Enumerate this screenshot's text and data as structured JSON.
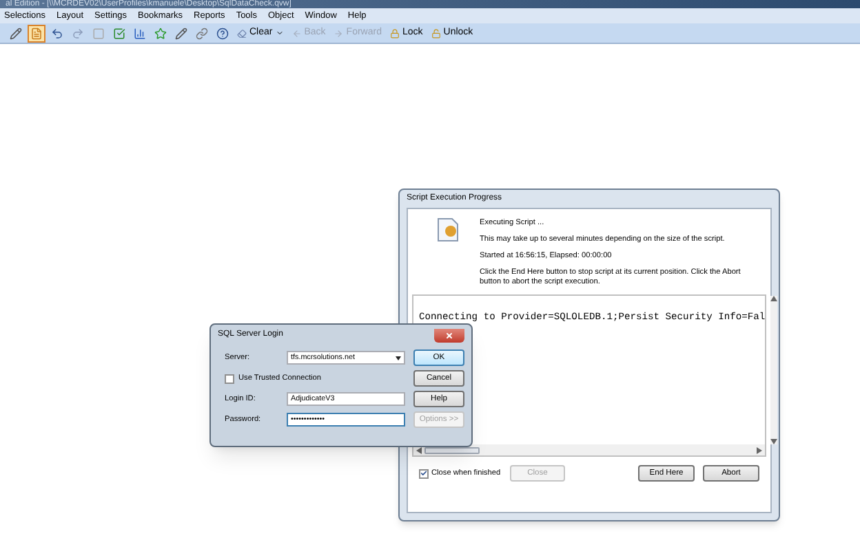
{
  "window": {
    "title": "al Edition - [\\\\MCRDEV02\\UserProfiles\\kmanuele\\Desktop\\SqlDataCheck.qvw]"
  },
  "menu": [
    "Selections",
    "Layout",
    "Settings",
    "Bookmarks",
    "Reports",
    "Tools",
    "Object",
    "Window",
    "Help"
  ],
  "toolbar": [
    {
      "kind": "icon",
      "selected": false
    },
    {
      "kind": "icon",
      "selected": true
    },
    {
      "kind": "icon",
      "selected": false
    },
    {
      "kind": "icon",
      "selected": false
    },
    {
      "kind": "icon",
      "selected": false
    },
    {
      "kind": "icon",
      "selected": false
    },
    {
      "kind": "icon",
      "selected": false
    },
    {
      "kind": "icon",
      "selected": false
    },
    {
      "kind": "icon",
      "selected": false
    },
    {
      "kind": "icon",
      "selected": false
    },
    {
      "kind": "icon",
      "selected": false
    },
    {
      "kind": "dropdown",
      "label": "Clear",
      "disabled": false
    },
    {
      "kind": "button",
      "label": "Back",
      "disabled": true
    },
    {
      "kind": "button",
      "label": "Forward",
      "disabled": true
    },
    {
      "kind": "button",
      "label": "Lock",
      "disabled": false
    },
    {
      "kind": "button",
      "label": "Unlock",
      "disabled": false
    }
  ],
  "script_dialog": {
    "title": "Script Execution Progress",
    "heading": "Executing Script ...",
    "lines": [
      "This may take up to several minutes depending on the size of the script.",
      "Started at 16:56:15, Elapsed: 00:00:00",
      "Click the End Here button to stop script at its current position. Click the Abort button to abort the script execution."
    ],
    "output": "Connecting to Provider=SQLOLEDB.1;Persist Security Info=Fal",
    "close_when_finished": {
      "label": "Close when finished",
      "checked": true
    },
    "buttons": [
      {
        "label": "Close",
        "disabled": true
      },
      {
        "label": "End Here",
        "disabled": false
      },
      {
        "label": "Abort",
        "disabled": false
      }
    ]
  },
  "login_dialog": {
    "title": "SQL Server Login",
    "server": {
      "label": "Server:",
      "value": "tfs.mcrsolutions.net"
    },
    "trusted": {
      "label": "Use Trusted Connection",
      "checked": false
    },
    "login_id": {
      "label": "Login ID:",
      "value": "AdjudicateV3"
    },
    "password": {
      "label": "Password:",
      "value": "•••••••••••••"
    },
    "buttons": [
      {
        "label": "OK",
        "disabled": false,
        "default": true
      },
      {
        "label": "Cancel",
        "disabled": false,
        "default": false
      },
      {
        "label": "Help",
        "disabled": false,
        "default": false
      },
      {
        "label": "Options >>",
        "disabled": true,
        "default": false
      }
    ]
  }
}
